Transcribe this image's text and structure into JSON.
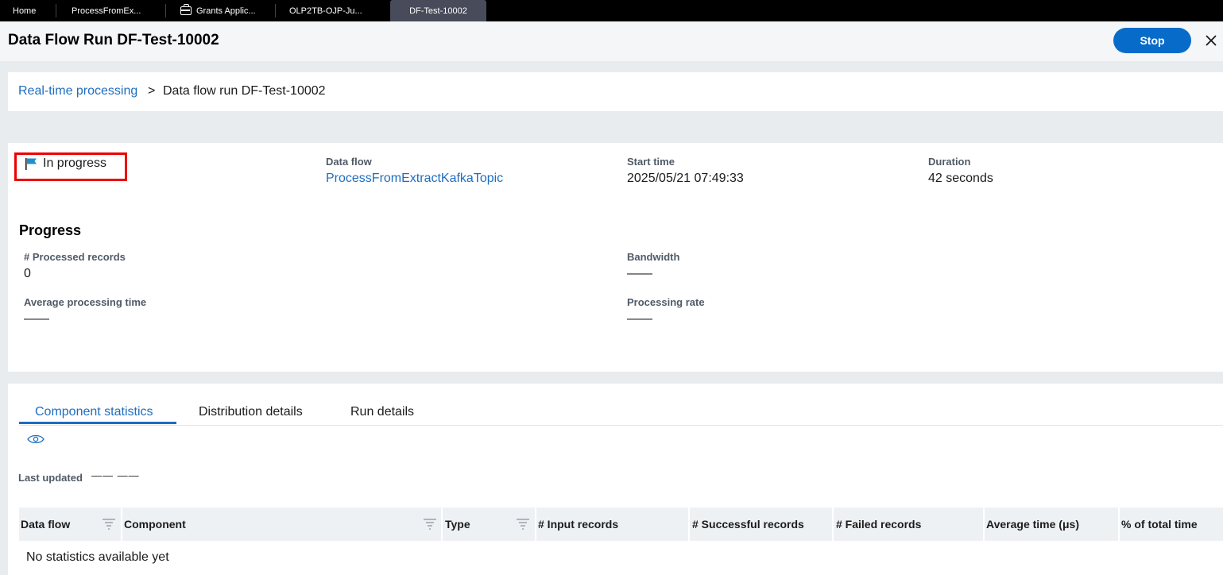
{
  "tabs": [
    {
      "label": "Home",
      "active": false,
      "icon": null
    },
    {
      "label": "ProcessFromEx...",
      "active": false,
      "icon": null
    },
    {
      "label": "Grants Applic...",
      "active": false,
      "icon": "briefcase-icon"
    },
    {
      "label": "OLP2TB-OJP-Ju...",
      "active": false,
      "icon": null
    },
    {
      "label": "DF-Test-10002",
      "active": true,
      "icon": null
    }
  ],
  "header": {
    "title": "Data Flow Run DF-Test-10002",
    "stop_label": "Stop",
    "close_icon": "close-icon"
  },
  "breadcrumb": {
    "parent": "Real-time processing",
    "separator": ">",
    "current": "Data flow run DF-Test-10002"
  },
  "summary": {
    "status": "In progress",
    "status_icon": "flag-icon",
    "data_flow_label": "Data flow",
    "data_flow_value": "ProcessFromExtractKafkaTopic",
    "start_time_label": "Start time",
    "start_time_value": "2025/05/21 07:49:33",
    "duration_label": "Duration",
    "duration_value": "42 seconds"
  },
  "progress": {
    "title": "Progress",
    "processed_label": "# Processed records",
    "processed_value": "0",
    "bandwidth_label": "Bandwidth",
    "bandwidth_value": "——",
    "avg_time_label": "Average processing time",
    "avg_time_value": "——",
    "rate_label": "Processing rate",
    "rate_value": "——"
  },
  "detail_tabs": [
    {
      "label": "Component statistics",
      "active": true
    },
    {
      "label": "Distribution details",
      "active": false
    },
    {
      "label": "Run details",
      "active": false
    }
  ],
  "stats": {
    "visibility_icon": "eye-icon",
    "last_updated_label": "Last updated",
    "last_updated_value": "—— ——",
    "columns": [
      "Data flow",
      "Component",
      "Type",
      "# Input records",
      "# Successful records",
      "# Failed records",
      "Average time (μs)",
      "% of total time"
    ],
    "empty_message": "No statistics available yet"
  },
  "colors": {
    "accent": "#076bc9",
    "link": "#1f6dbf",
    "highlight_border": "#ee0000",
    "flag": "#1f8fc9"
  }
}
